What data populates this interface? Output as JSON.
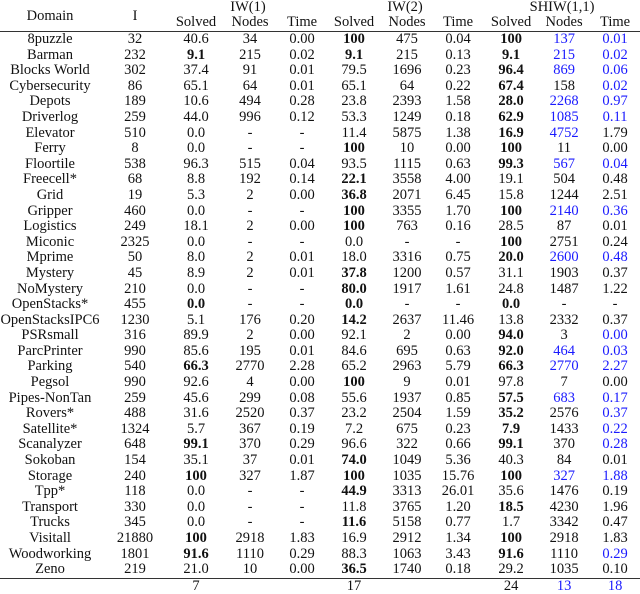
{
  "header": {
    "domain": "Domain",
    "instances": "I",
    "groups": [
      "IW(1)",
      "IW(2)",
      "SHIW(1,1)"
    ],
    "sub": [
      "Solved",
      "Nodes",
      "Time"
    ]
  },
  "colors": {
    "highlight": "#1a1aff"
  },
  "rows": [
    {
      "d": "8puzzle",
      "i": "32",
      "c": [
        "40.6",
        "34",
        "0.00",
        "100",
        "475",
        "0.04",
        "100",
        "137",
        "0.01"
      ],
      "bold": [
        3,
        6
      ],
      "blue": [
        7,
        8
      ]
    },
    {
      "d": "Barman",
      "i": "232",
      "c": [
        "9.1",
        "215",
        "0.02",
        "9.1",
        "215",
        "0.13",
        "9.1",
        "215",
        "0.02"
      ],
      "bold": [
        0,
        3,
        6
      ],
      "blue": [
        7,
        8
      ]
    },
    {
      "d": "Blocks World",
      "i": "302",
      "c": [
        "37.4",
        "91",
        "0.01",
        "79.5",
        "1696",
        "0.23",
        "96.4",
        "869",
        "0.06"
      ],
      "bold": [
        6
      ],
      "blue": [
        7,
        8
      ]
    },
    {
      "d": "Cybersecurity",
      "i": "86",
      "c": [
        "65.1",
        "64",
        "0.01",
        "65.1",
        "64",
        "0.22",
        "67.4",
        "158",
        "0.02"
      ],
      "bold": [
        6
      ],
      "blue": [
        8
      ]
    },
    {
      "d": "Depots",
      "i": "189",
      "c": [
        "10.6",
        "494",
        "0.28",
        "23.8",
        "2393",
        "1.58",
        "28.0",
        "2268",
        "0.97"
      ],
      "bold": [
        6
      ],
      "blue": [
        7,
        8
      ]
    },
    {
      "d": "Driverlog",
      "i": "259",
      "c": [
        "44.0",
        "996",
        "0.12",
        "53.3",
        "1249",
        "0.18",
        "62.9",
        "1085",
        "0.11"
      ],
      "bold": [
        6
      ],
      "blue": [
        7,
        8
      ]
    },
    {
      "d": "Elevator",
      "i": "510",
      "c": [
        "0.0",
        "-",
        "-",
        "11.4",
        "5875",
        "1.38",
        "16.9",
        "4752",
        "1.79"
      ],
      "bold": [
        6
      ],
      "blue": [
        7
      ]
    },
    {
      "d": "Ferry",
      "i": "8",
      "c": [
        "0.0",
        "-",
        "-",
        "100",
        "10",
        "0.00",
        "100",
        "11",
        "0.00"
      ],
      "bold": [
        3,
        6
      ],
      "blue": []
    },
    {
      "d": "Floortile",
      "i": "538",
      "c": [
        "96.3",
        "515",
        "0.04",
        "93.5",
        "1115",
        "0.63",
        "99.3",
        "567",
        "0.04"
      ],
      "bold": [
        6
      ],
      "blue": [
        7,
        8
      ]
    },
    {
      "d": "Freecell*",
      "i": "68",
      "c": [
        "8.8",
        "192",
        "0.14",
        "22.1",
        "3558",
        "4.00",
        "19.1",
        "504",
        "0.48"
      ],
      "bold": [
        3
      ],
      "blue": []
    },
    {
      "d": "Grid",
      "i": "19",
      "c": [
        "5.3",
        "2",
        "0.00",
        "36.8",
        "2071",
        "6.45",
        "15.8",
        "1244",
        "2.51"
      ],
      "bold": [
        3
      ],
      "blue": []
    },
    {
      "d": "Gripper",
      "i": "460",
      "c": [
        "0.0",
        "-",
        "-",
        "100",
        "3355",
        "1.70",
        "100",
        "2140",
        "0.36"
      ],
      "bold": [
        3,
        6
      ],
      "blue": [
        7,
        8
      ]
    },
    {
      "d": "Logistics",
      "i": "249",
      "c": [
        "18.1",
        "2",
        "0.00",
        "100",
        "763",
        "0.16",
        "28.5",
        "87",
        "0.01"
      ],
      "bold": [
        3
      ],
      "blue": []
    },
    {
      "d": "Miconic",
      "i": "2325",
      "c": [
        "0.0",
        "-",
        "-",
        "0.0",
        "-",
        "-",
        "100",
        "2751",
        "0.24"
      ],
      "bold": [
        6
      ],
      "blue": []
    },
    {
      "d": "Mprime",
      "i": "50",
      "c": [
        "8.0",
        "2",
        "0.01",
        "18.0",
        "3316",
        "0.75",
        "20.0",
        "2600",
        "0.48"
      ],
      "bold": [
        6
      ],
      "blue": [
        7,
        8
      ]
    },
    {
      "d": "Mystery",
      "i": "45",
      "c": [
        "8.9",
        "2",
        "0.01",
        "37.8",
        "1200",
        "0.57",
        "31.1",
        "1903",
        "0.37"
      ],
      "bold": [
        3
      ],
      "blue": []
    },
    {
      "d": "NoMystery",
      "i": "210",
      "c": [
        "0.0",
        "-",
        "-",
        "80.0",
        "1917",
        "1.61",
        "24.8",
        "1487",
        "1.22"
      ],
      "bold": [
        3
      ],
      "blue": []
    },
    {
      "d": "OpenStacks*",
      "i": "455",
      "c": [
        "0.0",
        "-",
        "-",
        "0.0",
        "-",
        "-",
        "0.0",
        "-",
        "-"
      ],
      "bold": [
        0,
        3,
        6
      ],
      "blue": []
    },
    {
      "d": "OpenStacksIPC6",
      "i": "1230",
      "c": [
        "5.1",
        "176",
        "0.20",
        "14.2",
        "2637",
        "11.46",
        "13.8",
        "2332",
        "0.37"
      ],
      "bold": [
        3
      ],
      "blue": []
    },
    {
      "d": "PSRsmall",
      "i": "316",
      "c": [
        "89.9",
        "2",
        "0.00",
        "92.1",
        "2",
        "0.00",
        "94.0",
        "3",
        "0.00"
      ],
      "bold": [
        6
      ],
      "blue": [
        8
      ]
    },
    {
      "d": "ParcPrinter",
      "i": "990",
      "c": [
        "85.6",
        "195",
        "0.01",
        "84.6",
        "695",
        "0.63",
        "92.0",
        "464",
        "0.03"
      ],
      "bold": [
        6
      ],
      "blue": [
        7,
        8
      ]
    },
    {
      "d": "Parking",
      "i": "540",
      "c": [
        "66.3",
        "2770",
        "2.28",
        "65.2",
        "2963",
        "5.79",
        "66.3",
        "2770",
        "2.27"
      ],
      "bold": [
        0,
        6
      ],
      "blue": [
        7,
        8
      ]
    },
    {
      "d": "Pegsol",
      "i": "990",
      "c": [
        "92.6",
        "4",
        "0.00",
        "100",
        "9",
        "0.01",
        "97.8",
        "7",
        "0.00"
      ],
      "bold": [
        3
      ],
      "blue": []
    },
    {
      "d": "Pipes-NonTan",
      "i": "259",
      "c": [
        "45.6",
        "299",
        "0.08",
        "55.6",
        "1937",
        "0.85",
        "57.5",
        "683",
        "0.17"
      ],
      "bold": [
        6
      ],
      "blue": [
        7,
        8
      ]
    },
    {
      "d": "Rovers*",
      "i": "488",
      "c": [
        "31.6",
        "2520",
        "0.37",
        "23.2",
        "2504",
        "1.59",
        "35.2",
        "2576",
        "0.37"
      ],
      "bold": [
        6
      ],
      "blue": [
        8
      ]
    },
    {
      "d": "Satellite*",
      "i": "1324",
      "c": [
        "5.7",
        "367",
        "0.19",
        "7.2",
        "675",
        "0.23",
        "7.9",
        "1433",
        "0.22"
      ],
      "bold": [
        6
      ],
      "blue": [
        8
      ]
    },
    {
      "d": "Scanalyzer",
      "i": "648",
      "c": [
        "99.1",
        "370",
        "0.29",
        "96.6",
        "322",
        "0.66",
        "99.1",
        "370",
        "0.28"
      ],
      "bold": [
        0,
        6
      ],
      "blue": [
        8
      ]
    },
    {
      "d": "Sokoban",
      "i": "154",
      "c": [
        "35.1",
        "37",
        "0.01",
        "74.0",
        "1049",
        "5.36",
        "40.3",
        "84",
        "0.01"
      ],
      "bold": [
        3
      ],
      "blue": []
    },
    {
      "d": "Storage",
      "i": "240",
      "c": [
        "100",
        "327",
        "1.87",
        "100",
        "1035",
        "15.76",
        "100",
        "327",
        "1.88"
      ],
      "bold": [
        0,
        3,
        6
      ],
      "blue": [
        7,
        8
      ]
    },
    {
      "d": "Tpp*",
      "i": "118",
      "c": [
        "0.0",
        "-",
        "-",
        "44.9",
        "3313",
        "26.01",
        "35.6",
        "1476",
        "0.19"
      ],
      "bold": [
        3
      ],
      "blue": []
    },
    {
      "d": "Transport",
      "i": "330",
      "c": [
        "0.0",
        "-",
        "-",
        "11.8",
        "3765",
        "1.20",
        "18.5",
        "4230",
        "1.96"
      ],
      "bold": [
        6
      ],
      "blue": []
    },
    {
      "d": "Trucks",
      "i": "345",
      "c": [
        "0.0",
        "-",
        "-",
        "11.6",
        "5158",
        "0.77",
        "1.7",
        "3342",
        "0.47"
      ],
      "bold": [
        3
      ],
      "blue": []
    },
    {
      "d": "Visitall",
      "i": "21880",
      "c": [
        "100",
        "2918",
        "1.83",
        "16.9",
        "2912",
        "1.34",
        "100",
        "2918",
        "1.83"
      ],
      "bold": [
        0,
        6
      ],
      "blue": []
    },
    {
      "d": "Woodworking",
      "i": "1801",
      "c": [
        "91.6",
        "1110",
        "0.29",
        "88.3",
        "1063",
        "3.43",
        "91.6",
        "1110",
        "0.29"
      ],
      "bold": [
        0,
        6
      ],
      "blue": [
        8
      ]
    },
    {
      "d": "Zeno",
      "i": "219",
      "c": [
        "21.0",
        "10",
        "0.00",
        "36.5",
        "1740",
        "0.18",
        "29.2",
        "1035",
        "0.10"
      ],
      "bold": [
        3
      ],
      "blue": []
    }
  ],
  "footer": {
    "c": [
      "7",
      "",
      "",
      "17",
      "",
      "",
      "24",
      "13",
      "18"
    ],
    "blue": [
      7,
      8
    ]
  }
}
